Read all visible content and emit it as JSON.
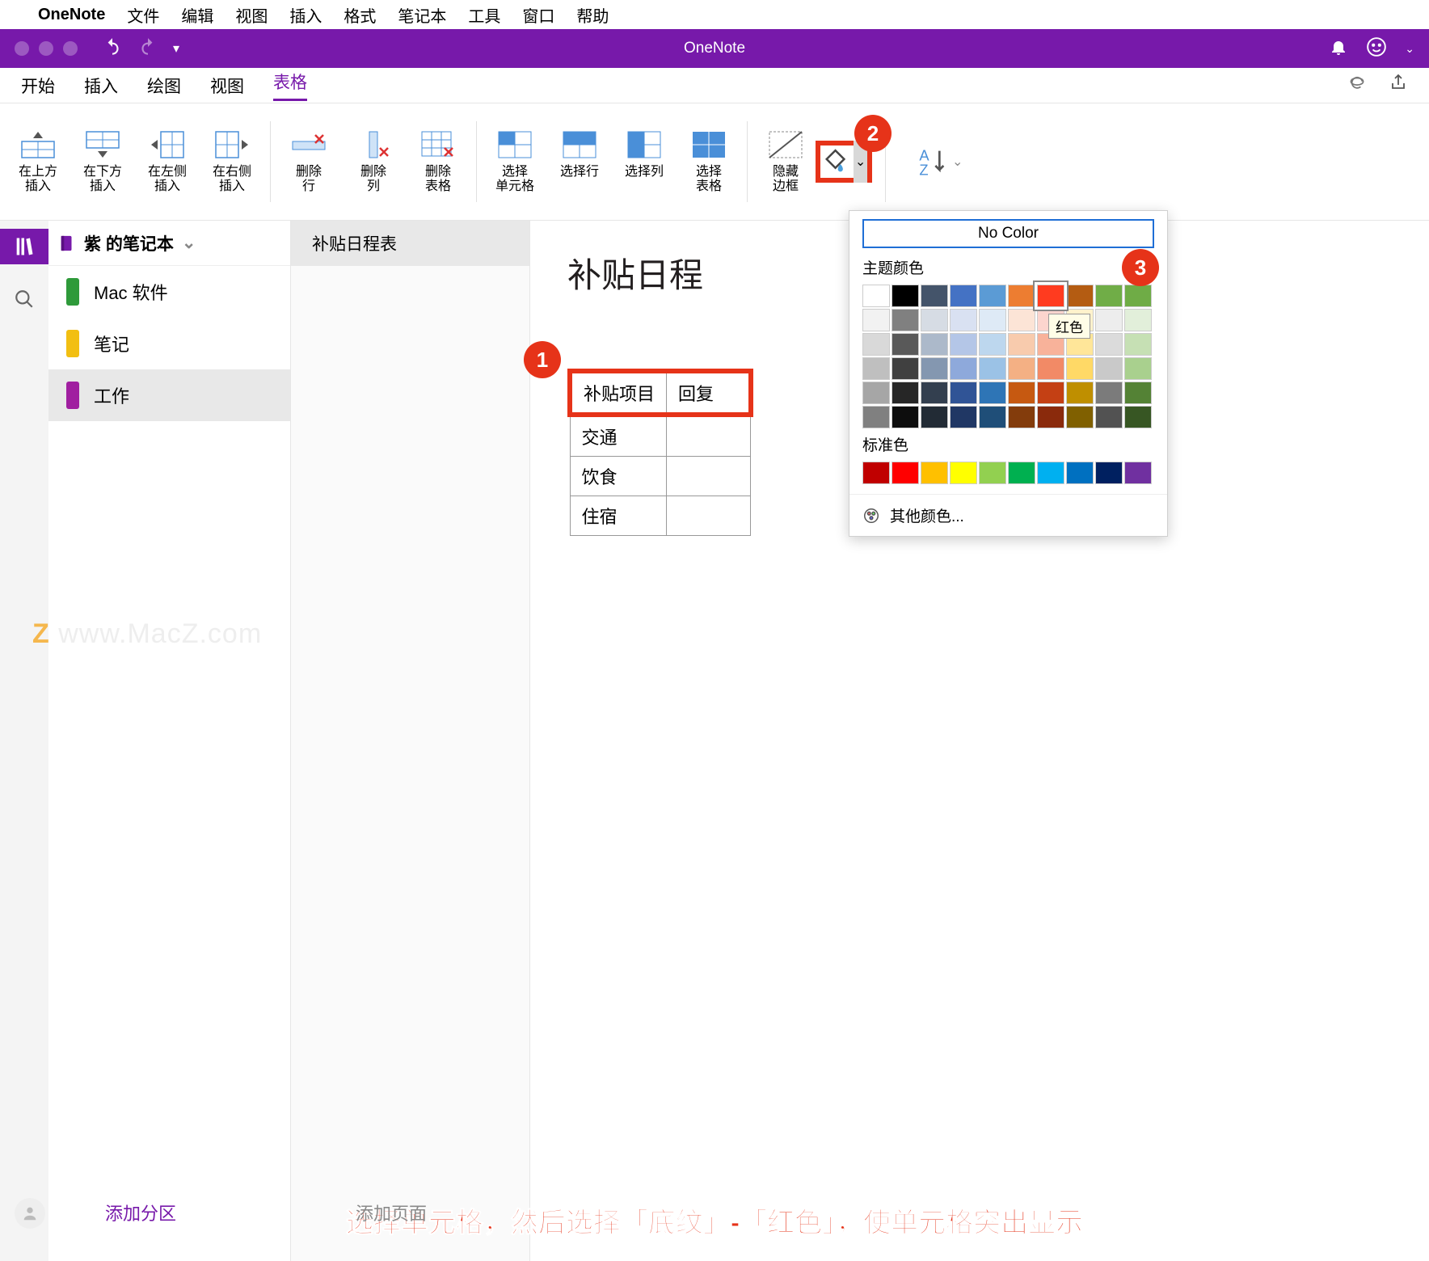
{
  "menubar": {
    "app_name": "OneNote",
    "items": [
      "文件",
      "编辑",
      "视图",
      "插入",
      "格式",
      "笔记本",
      "工具",
      "窗口",
      "帮助"
    ]
  },
  "titlebar": {
    "title": "OneNote"
  },
  "ribbon_tabs": {
    "items": [
      "开始",
      "插入",
      "绘图",
      "视图",
      "表格"
    ],
    "active_index": 4
  },
  "ribbon": {
    "insert_above": "在上方\n插入",
    "insert_below": "在下方\n插入",
    "insert_left": "在左侧\n插入",
    "insert_right": "在右侧\n插入",
    "delete_row": "删除\n行",
    "delete_col": "删除\n列",
    "delete_table": "删除\n表格",
    "select_cell": "选择\n单元格",
    "select_row": "选择行",
    "select_col": "选择列",
    "select_table": "选择\n表格",
    "hide_borders": "隐藏\n边框"
  },
  "notebook": {
    "name": "紫 的笔记本",
    "sections": [
      {
        "label": "Mac 软件",
        "color": "#2e9a3a"
      },
      {
        "label": "笔记",
        "color": "#f2bf12"
      },
      {
        "label": "工作",
        "color": "#a01fa0"
      }
    ],
    "active_section": 2,
    "pages": [
      "补贴日程表"
    ]
  },
  "page": {
    "title": "补贴日程",
    "table": {
      "header": [
        "补贴项目",
        "回复"
      ],
      "rows": [
        "交通",
        "饮食",
        "住宿"
      ]
    }
  },
  "color_popup": {
    "no_color": "No Color",
    "theme_label": "主题颜色",
    "standard_label": "标准色",
    "more_colors": "其他颜色...",
    "tooltip": "红色",
    "theme_row1": [
      "#ffffff",
      "#000000",
      "#44546a",
      "#4472c4",
      "#5b9bd5",
      "#ed7d31",
      "#ff3b1f",
      "#b45c12",
      "#70ad47",
      "#6fac46"
    ],
    "theme_shades": [
      [
        "#f2f2f2",
        "#808080",
        "#d6dce4",
        "#d9e1f2",
        "#deeaf6",
        "#fce4d6",
        "#fcd5ce",
        "#fff2cc",
        "#ededed",
        "#e2efda"
      ],
      [
        "#d9d9d9",
        "#595959",
        "#acb9ca",
        "#b4c6e7",
        "#bdd7ee",
        "#f8cbad",
        "#f8b29a",
        "#ffe699",
        "#dbdbdb",
        "#c6e0b4"
      ],
      [
        "#bfbfbf",
        "#404040",
        "#8497b0",
        "#8ea9db",
        "#9bc2e6",
        "#f4b084",
        "#f28a66",
        "#ffd966",
        "#c9c9c9",
        "#a9d08e"
      ],
      [
        "#a6a6a6",
        "#262626",
        "#333f4f",
        "#305496",
        "#2e75b6",
        "#c65911",
        "#c44014",
        "#bf8f00",
        "#7b7b7b",
        "#548235"
      ],
      [
        "#808080",
        "#0d0d0d",
        "#222b35",
        "#203764",
        "#1f4e78",
        "#833c0c",
        "#8a2a0c",
        "#806000",
        "#525252",
        "#375623"
      ]
    ],
    "standard": [
      "#c00000",
      "#ff0000",
      "#ffc000",
      "#ffff00",
      "#92d050",
      "#00b050",
      "#00b0f0",
      "#0070c0",
      "#002060",
      "#7030a0"
    ]
  },
  "annotations": {
    "one": "1",
    "two": "2",
    "three": "3"
  },
  "caption": "选择单元格，然后选择「底纹」-「红色」，使单元格突出显示",
  "watermark": "www.MacZ.com",
  "bottom": {
    "add_section": "添加分区",
    "add_page": "添加页面"
  }
}
